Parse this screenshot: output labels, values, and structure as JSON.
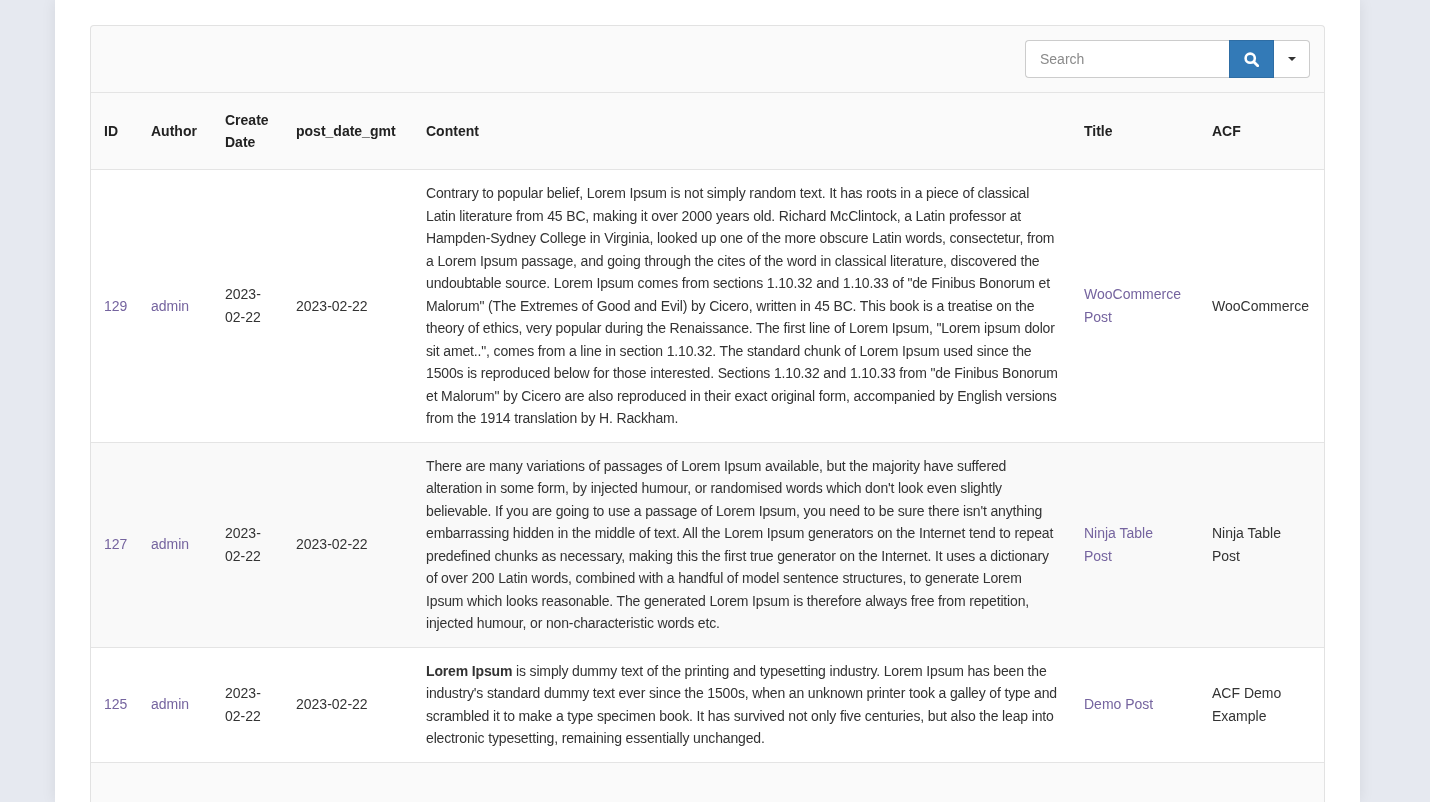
{
  "search": {
    "placeholder": "Search"
  },
  "table": {
    "columns": [
      {
        "label": "ID",
        "kind": "link"
      },
      {
        "label": "Author",
        "kind": "link"
      },
      {
        "label": "Create Date",
        "kind": "text"
      },
      {
        "label": "post_date_gmt",
        "kind": "text"
      },
      {
        "label": "Content",
        "kind": "text"
      },
      {
        "label": "Title",
        "kind": "link"
      },
      {
        "label": "ACF",
        "kind": "text"
      }
    ],
    "rows": [
      {
        "cells": [
          "129",
          "admin",
          "2023-02-22",
          "2023-02-22",
          "Contrary to popular belief, Lorem Ipsum is not simply random text. It has roots in a piece of classical Latin literature from 45 BC, making it over 2000 years old. Richard McClintock, a Latin professor at Hampden-Sydney College in Virginia, looked up one of the more obscure Latin words, consectetur, from a Lorem Ipsum passage, and going through the cites of the word in classical literature, discovered the undoubtable source. Lorem Ipsum comes from sections 1.10.32 and 1.10.33 of \"de Finibus Bonorum et Malorum\" (The Extremes of Good and Evil) by Cicero, written in 45 BC. This book is a treatise on the theory of ethics, very popular during the Renaissance. The first line of Lorem Ipsum, \"Lorem ipsum dolor sit amet..\", comes from a line in section 1.10.32. The standard chunk of Lorem Ipsum used since the 1500s is reproduced below for those interested. Sections 1.10.32 and 1.10.33 from \"de Finibus Bonorum et Malorum\" by Cicero are also reproduced in their exact original form, accompanied by English versions from the 1914 translation by H. Rackham.",
          "WooCommerce Post",
          "WooCommerce"
        ]
      },
      {
        "cells": [
          "127",
          "admin",
          "2023-02-22",
          "2023-02-22",
          "There are many variations of passages of Lorem Ipsum available, but the majority have suffered alteration in some form, by injected humour, or randomised words which don't look even slightly believable. If you are going to use a passage of Lorem Ipsum, you need to be sure there isn't anything embarrassing hidden in the middle of text. All the Lorem Ipsum generators on the Internet tend to repeat predefined chunks as necessary, making this the first true generator on the Internet. It uses a dictionary of over 200 Latin words, combined with a handful of model sentence structures, to generate Lorem Ipsum which looks reasonable. The generated Lorem Ipsum is therefore always free from repetition, injected humour, or non-characteristic words etc.",
          "Ninja Table Post",
          "Ninja Table Post"
        ]
      },
      {
        "cells": [
          "125",
          "admin",
          "2023-02-22",
          "2023-02-22",
          "**Lorem Ipsum** is simply dummy text of the printing and typesetting industry. Lorem Ipsum has been the industry's standard dummy text ever since the 1500s, when an unknown printer took a galley of type and scrambled it to make a type specimen book. It has survived not only five centuries, but also the leap into electronic typesetting, remaining essentially unchanged.",
          "Demo Post",
          "ACF Demo Example"
        ]
      }
    ]
  }
}
